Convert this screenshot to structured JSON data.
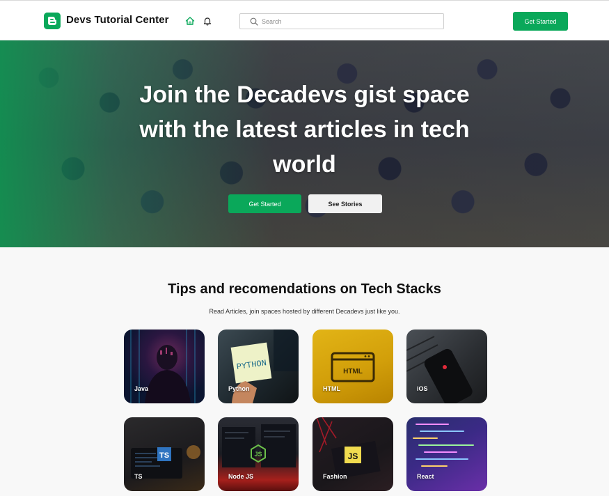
{
  "header": {
    "brand": "Devs Tutorial Center",
    "search_placeholder": "Search",
    "cta_label": "Get Started"
  },
  "hero": {
    "title": "Join the Decadevs gist space with the latest articles in tech world",
    "primary_label": "Get Started",
    "secondary_label": "See Stories"
  },
  "section": {
    "title": "Tips and recomendations on Tech Stacks",
    "subtitle": "Read Articles, join spaces hosted by different Decadevs just like you."
  },
  "cards": [
    {
      "label": "Java"
    },
    {
      "label": "Python"
    },
    {
      "label": "HTML"
    },
    {
      "label": "iOS"
    },
    {
      "label": "TS"
    },
    {
      "label": "Node JS"
    },
    {
      "label": "Fashion"
    },
    {
      "label": "React"
    }
  ],
  "art_text": {
    "python": "PYTHON",
    "html": "HTML",
    "ts": "TS",
    "node": "JS",
    "fashion": "JS"
  },
  "colors": {
    "accent": "#0aa85a",
    "secondary_button": "#f1f1f1",
    "page_background": "#f8f8f8"
  }
}
